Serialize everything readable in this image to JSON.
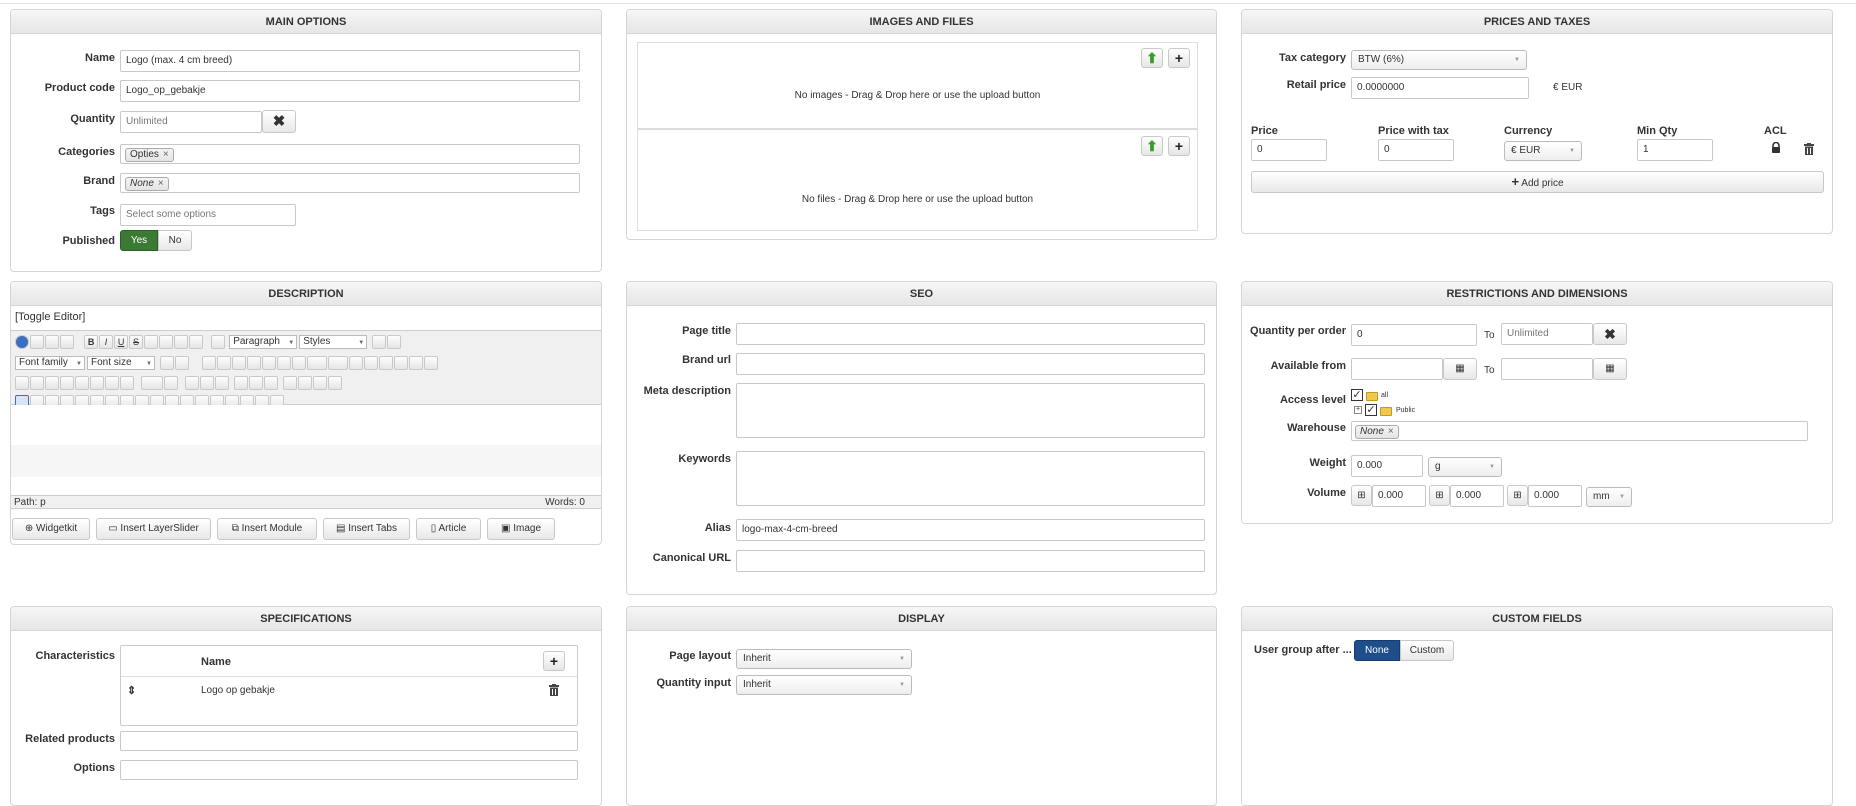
{
  "main_options": {
    "title": "MAIN OPTIONS",
    "name_label": "Name",
    "name_value": "Logo (max. 4 cm breed)",
    "code_label": "Product code",
    "code_value": "Logo_op_gebakje",
    "quantity_label": "Quantity",
    "quantity_value": "Unlimited",
    "categories_label": "Categories",
    "categories_chip": "Opties",
    "brand_label": "Brand",
    "brand_chip": "None",
    "tags_label": "Tags",
    "tags_placeholder": "Select some options",
    "published_label": "Published",
    "published_yes": "Yes",
    "published_no": "No"
  },
  "images_files": {
    "title": "IMAGES AND FILES",
    "no_images": "No images - Drag & Drop here or use the upload button",
    "no_files": "No files - Drag & Drop here or use the upload button"
  },
  "prices": {
    "title": "PRICES AND TAXES",
    "tax_label": "Tax category",
    "tax_value": "BTW (6%)",
    "retail_label": "Retail price",
    "retail_value": "0.0000000",
    "retail_currency": "€ EUR",
    "col_price": "Price",
    "col_price_tax": "Price with tax",
    "col_currency": "Currency",
    "col_minqty": "Min Qty",
    "col_acl": "ACL",
    "price_value": "0",
    "price_tax_value": "0",
    "currency_value": "€ EUR",
    "minqty_value": "1",
    "add_price": "Add price"
  },
  "description": {
    "title": "DESCRIPTION",
    "toggle": "[Toggle Editor]",
    "paragraph": "Paragraph",
    "styles": "Styles",
    "font_family": "Font family",
    "font_size": "Font size",
    "path": "Path: p",
    "words": "Words: 0",
    "buttons": [
      "Widgetkit",
      "Insert LayerSlider",
      "Insert Module",
      "Insert Tabs",
      "Article",
      "Image"
    ]
  },
  "seo": {
    "title": "SEO",
    "page_title_label": "Page title",
    "brand_url_label": "Brand url",
    "meta_label": "Meta description",
    "keywords_label": "Keywords",
    "alias_label": "Alias",
    "alias_value": "logo-max-4-cm-breed",
    "canonical_label": "Canonical URL"
  },
  "restrictions": {
    "title": "RESTRICTIONS AND DIMENSIONS",
    "qty_order_label": "Quantity per order",
    "qty_from": "0",
    "to": "To",
    "qty_to": "Unlimited",
    "available_label": "Available from",
    "access_label": "Access level",
    "access_all": "all",
    "access_public": "Public",
    "warehouse_label": "Warehouse",
    "warehouse_chip": "None",
    "weight_label": "Weight",
    "weight_value": "0.000",
    "weight_unit": "g",
    "volume_label": "Volume",
    "vol1": "0.000",
    "vol2": "0.000",
    "vol3": "0.000",
    "volume_unit": "mm"
  },
  "specifications": {
    "title": "SPECIFICATIONS",
    "characteristics_label": "Characteristics",
    "col_name": "Name",
    "row_name": "Logo op gebakje",
    "related_label": "Related products",
    "options_label": "Options"
  },
  "display": {
    "title": "DISPLAY",
    "layout_label": "Page layout",
    "layout_value": "Inherit",
    "qty_input_label": "Quantity input",
    "qty_input_value": "Inherit"
  },
  "custom_fields": {
    "title": "CUSTOM FIELDS",
    "usergroup_label": "User group after ...",
    "none": "None",
    "custom": "Custom"
  },
  "colors": {
    "published_yes_bg": "#3a7a34",
    "none_active_bg": "#1f4f8a"
  }
}
